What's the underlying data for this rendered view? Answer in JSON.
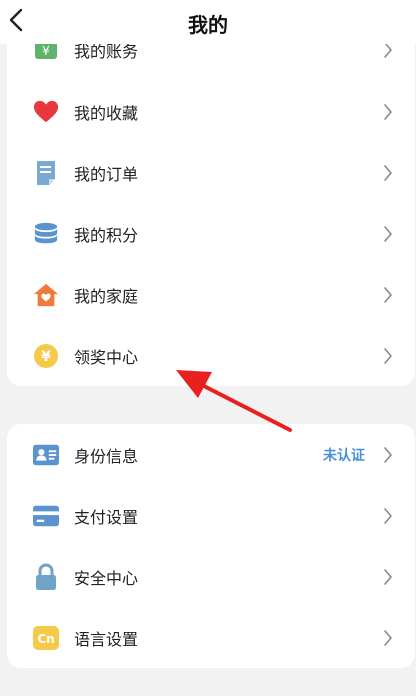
{
  "header": {
    "title": "我的"
  },
  "section1": {
    "items": [
      {
        "label": "我的账务",
        "icon": "finance-icon"
      },
      {
        "label": "我的收藏",
        "icon": "heart-icon"
      },
      {
        "label": "我的订单",
        "icon": "order-document-icon"
      },
      {
        "label": "我的积分",
        "icon": "points-stack-icon"
      },
      {
        "label": "我的家庭",
        "icon": "home-icon"
      },
      {
        "label": "领奖中心",
        "icon": "yen-coin-icon"
      }
    ]
  },
  "section2": {
    "items": [
      {
        "label": "身份信息",
        "icon": "id-card-icon",
        "status": "未认证"
      },
      {
        "label": "支付设置",
        "icon": "credit-card-icon"
      },
      {
        "label": "安全中心",
        "icon": "lock-icon"
      },
      {
        "label": "语言设置",
        "icon": "language-cn-icon"
      }
    ]
  },
  "colors": {
    "accent_blue": "#4a90d9",
    "heart_red": "#e8383d",
    "home_orange": "#f07a3c",
    "coin_yellow": "#f7c948",
    "annotation_arrow": "#e8201e"
  }
}
